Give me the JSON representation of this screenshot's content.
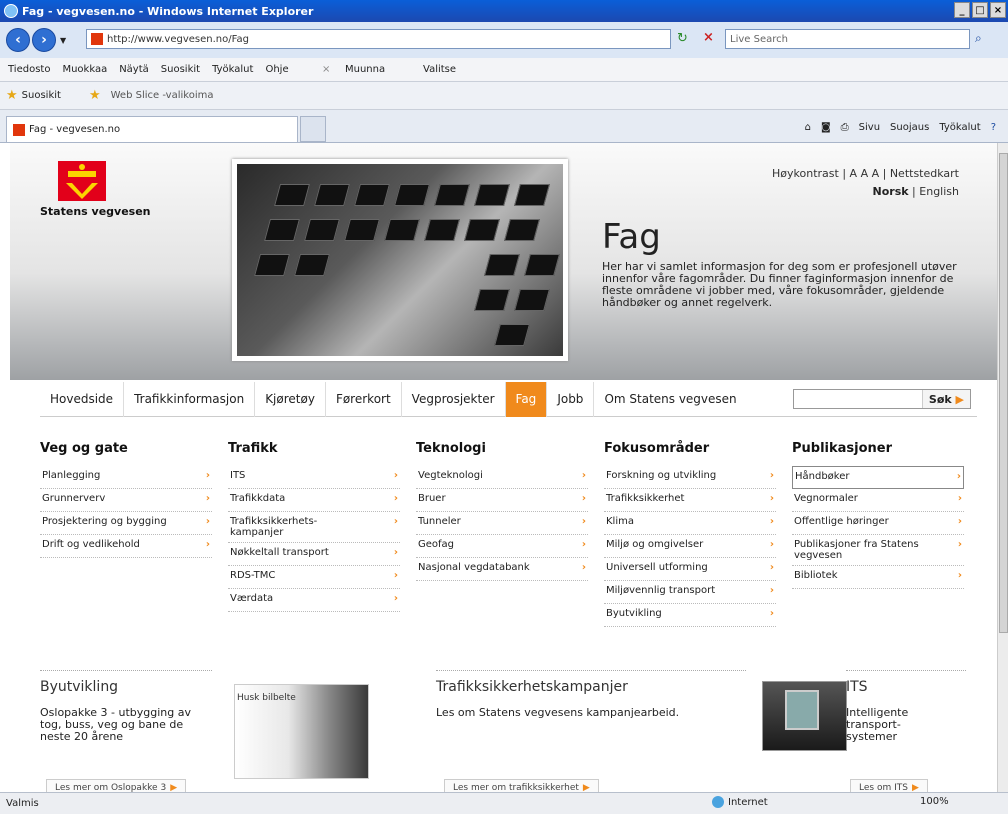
{
  "browser": {
    "title": "Fag - vegvesen.no - Windows Internet Explorer",
    "url": "http://www.vegvesen.no/Fag",
    "search_placeholder": "Live Search",
    "menu": [
      "Tiedosto",
      "Muokkaa",
      "Näytä",
      "Suosikit",
      "Työkalut",
      "Ohje"
    ],
    "menu_right": [
      "Muunna",
      "Valitse"
    ],
    "fav_label": "Suosikit",
    "webslice": "Web Slice -valikoima",
    "tab_title": "Fag - vegvesen.no",
    "cmd": [
      "Sivu",
      "Suojaus",
      "Työkalut"
    ],
    "status_left": "Valmis",
    "status_zone": "Internet",
    "status_zoom": "100%"
  },
  "site": {
    "brand": "Statens vegvesen",
    "toplinks": {
      "hoykontrast": "Høykontrast",
      "aaa": "A A A",
      "nettsted": "Nettstedkart",
      "norsk": "Norsk",
      "english": "English"
    },
    "hero_title": "Fag",
    "hero_text": "Her har vi samlet informasjon for deg som er profesjonell utøver innenfor våre fagområder. Du finner faginformasjon innenfor de fleste områdene vi jobber med, våre fokusområder, gjeldende håndbøker og annet regelverk.",
    "nav": [
      "Hovedside",
      "Trafikkinformasjon",
      "Kjøretøy",
      "Førerkort",
      "Vegprosjekter",
      "Fag",
      "Jobb",
      "Om Statens vegvesen"
    ],
    "search_btn": "Søk",
    "columns": [
      {
        "title": "Veg og gate",
        "links": [
          "Planlegging",
          "Grunnerverv",
          "Prosjektering og bygging",
          "Drift og vedlikehold"
        ]
      },
      {
        "title": "Trafikk",
        "links": [
          "ITS",
          "Trafikkdata",
          "Trafikksikkerhets-kampanjer",
          "Nøkkeltall transport",
          "RDS-TMC",
          "Værdata"
        ]
      },
      {
        "title": "Teknologi",
        "links": [
          "Vegteknologi",
          "Bruer",
          "Tunneler",
          "Geofag",
          "Nasjonal vegdatabank"
        ]
      },
      {
        "title": "Fokusområder",
        "links": [
          "Forskning og utvikling",
          "Trafikksikkerhet",
          "Klima",
          "Miljø og omgivelser",
          "Universell utforming",
          "Miljøvennlig transport",
          "Byutvikling"
        ]
      },
      {
        "title": "Publikasjoner",
        "links": [
          "Håndbøker",
          "Vegnormaler",
          "Offentlige høringer",
          "Publikasjoner fra Statens vegvesen",
          "Bibliotek"
        ]
      }
    ],
    "promos": {
      "byutvikling": {
        "title": "Byutvikling",
        "text": "Oslopakke 3 - utbygging av tog, buss, veg og bane de neste 20 årene",
        "btn": "Les mer om Oslopakke 3"
      },
      "kampanjer": {
        "title": "Trafikksikkerhetskampanjer",
        "text": "Les om Statens vegvesens kampanjearbeid.",
        "btn": "Les mer om trafikksikkerhet",
        "img_caption": "Husk bilbelte"
      },
      "its": {
        "title": "ITS",
        "text": "Intelligente transport-systemer",
        "btn": "Les om ITS"
      }
    }
  }
}
